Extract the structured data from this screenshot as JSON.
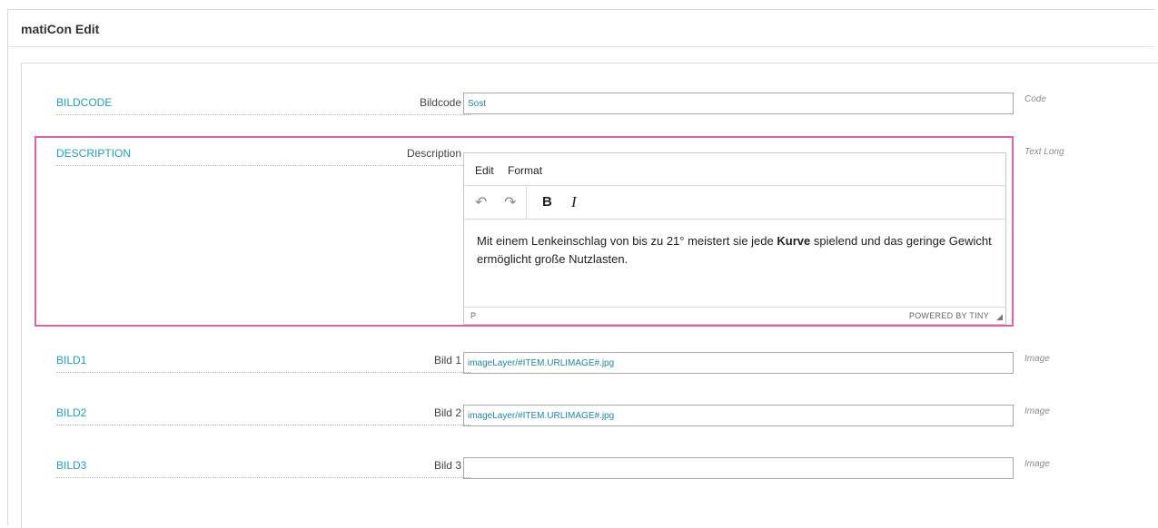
{
  "window": {
    "title": "matiCon Edit"
  },
  "fields": {
    "bildcode": {
      "name": "BILDCODE",
      "caption": "Bildcode",
      "value": "Sost",
      "type": "Code"
    },
    "description": {
      "name": "DESCRIPTION",
      "caption": "Description",
      "type": "Text Long",
      "editor": {
        "menu": [
          "Edit",
          "Format"
        ],
        "tools": {
          "undo": "↶",
          "redo": "↷",
          "bold": "B",
          "italic": "I"
        },
        "content_before": "Mit einem Lenkeinschlag von bis zu 21° meistert sie jede ",
        "content_bold": "Kurve",
        "content_after": " spielend und das geringe Gewicht ermöglicht große Nutzlasten.",
        "status_path": "P",
        "status_brand": "POWERED BY TINY"
      }
    },
    "bild1": {
      "name": "BILD1",
      "caption": "Bild 1",
      "value": "imageLayer/#ITEM.URLIMAGE#.jpg",
      "type": "Image"
    },
    "bild2": {
      "name": "BILD2",
      "caption": "Bild 2",
      "value": "imageLayer/#ITEM.URLIMAGE#.jpg",
      "type": "Image"
    },
    "bild3": {
      "name": "BILD3",
      "caption": "Bild 3",
      "value": "",
      "type": "Image"
    }
  },
  "colors": {
    "accent": "#1aa3b8",
    "highlight": "#e060a8"
  }
}
